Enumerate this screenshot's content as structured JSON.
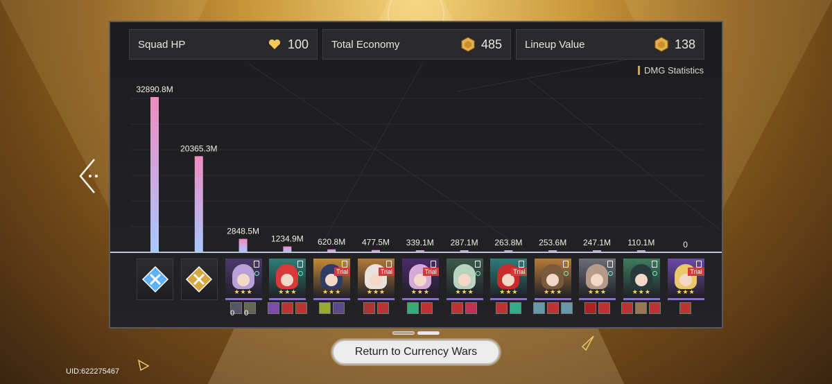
{
  "stats": {
    "squad_hp_label": "Squad HP",
    "squad_hp_value": "100",
    "total_economy_label": "Total Economy",
    "total_economy_value": "485",
    "lineup_value_label": "Lineup Value",
    "lineup_value_value": "138"
  },
  "legend": {
    "label": "DMG Statistics"
  },
  "chart_data": {
    "type": "bar",
    "values": [
      32890.8,
      20365.3,
      2848.5,
      1234.9,
      620.8,
      477.5,
      339.1,
      287.1,
      263.8,
      253.6,
      247.1,
      110.1,
      0
    ],
    "value_labels": [
      "32890.8M",
      "20365.3M",
      "2848.5M",
      "1234.9M",
      "620.8M",
      "477.5M",
      "339.1M",
      "287.1M",
      "263.8M",
      "253.6M",
      "247.1M",
      "110.1M",
      "0"
    ],
    "unit": "M",
    "grid": true,
    "bar_colors": [
      "#f08bc0",
      "#a8c8ff"
    ]
  },
  "roster": [
    {
      "kind": "element",
      "icon": "imaginary-element-icon",
      "color": "#5fb0ff"
    },
    {
      "kind": "element",
      "icon": "physical-element-icon",
      "color": "#d8a640"
    },
    {
      "kind": "character",
      "trial": false,
      "hair": "#b7a1d6",
      "bg": "#4b3a6e",
      "relics": [
        {
          "color": "#556",
          "count": "0"
        },
        {
          "color": "#665",
          "count": "0"
        }
      ]
    },
    {
      "kind": "character",
      "trial": false,
      "hair": "#d83a3a",
      "bg": "#2e7f76",
      "relics": [
        {
          "color": "#7b4ca8"
        },
        {
          "color": "#b33"
        },
        {
          "color": "#b33"
        }
      ]
    },
    {
      "kind": "character",
      "trial": true,
      "hair": "#2f3d66",
      "bg": "#c38a3c",
      "relics": [
        {
          "color": "#9a3"
        },
        {
          "color": "#5a4a8a"
        }
      ]
    },
    {
      "kind": "character",
      "trial": true,
      "hair": "#e8e2dc",
      "bg": "#b07a3a",
      "relics": [
        {
          "color": "#a33"
        },
        {
          "color": "#b33"
        }
      ]
    },
    {
      "kind": "character",
      "trial": true,
      "hair": "#d7a9d9",
      "bg": "#4a2b6e",
      "relics": [
        {
          "color": "#3a7"
        },
        {
          "color": "#b33"
        }
      ]
    },
    {
      "kind": "character",
      "trial": false,
      "hair": "#b9d3c0",
      "bg": "#3c5c4c",
      "relics": [
        {
          "color": "#b33"
        },
        {
          "color": "#b35"
        }
      ]
    },
    {
      "kind": "character",
      "trial": true,
      "hair": "#c92a2a",
      "bg": "#2f7c7a",
      "relics": [
        {
          "color": "#b33"
        },
        {
          "color": "#3a8"
        }
      ]
    },
    {
      "kind": "character",
      "trial": false,
      "hair": "#7a5a3c",
      "bg": "#b77a3a",
      "relics": [
        {
          "color": "#69a"
        },
        {
          "color": "#b33"
        },
        {
          "color": "#69a"
        }
      ]
    },
    {
      "kind": "character",
      "trial": false,
      "hair": "#b59a8a",
      "bg": "#6d6d78",
      "relics": [
        {
          "color": "#a22"
        },
        {
          "color": "#b33"
        }
      ]
    },
    {
      "kind": "character",
      "trial": false,
      "hair": "#263b3a",
      "bg": "#3e7c5e",
      "relics": [
        {
          "color": "#b33"
        },
        {
          "color": "#975"
        },
        {
          "color": "#b33"
        }
      ]
    },
    {
      "kind": "character",
      "trial": true,
      "hair": "#e8c86a",
      "bg": "#6b4aa8",
      "relics": [
        {
          "color": "#b33"
        }
      ]
    }
  ],
  "stars": "★★★",
  "trial_label": "Trial",
  "return_button": "Return to Currency Wars",
  "uid": "UID:622275467"
}
